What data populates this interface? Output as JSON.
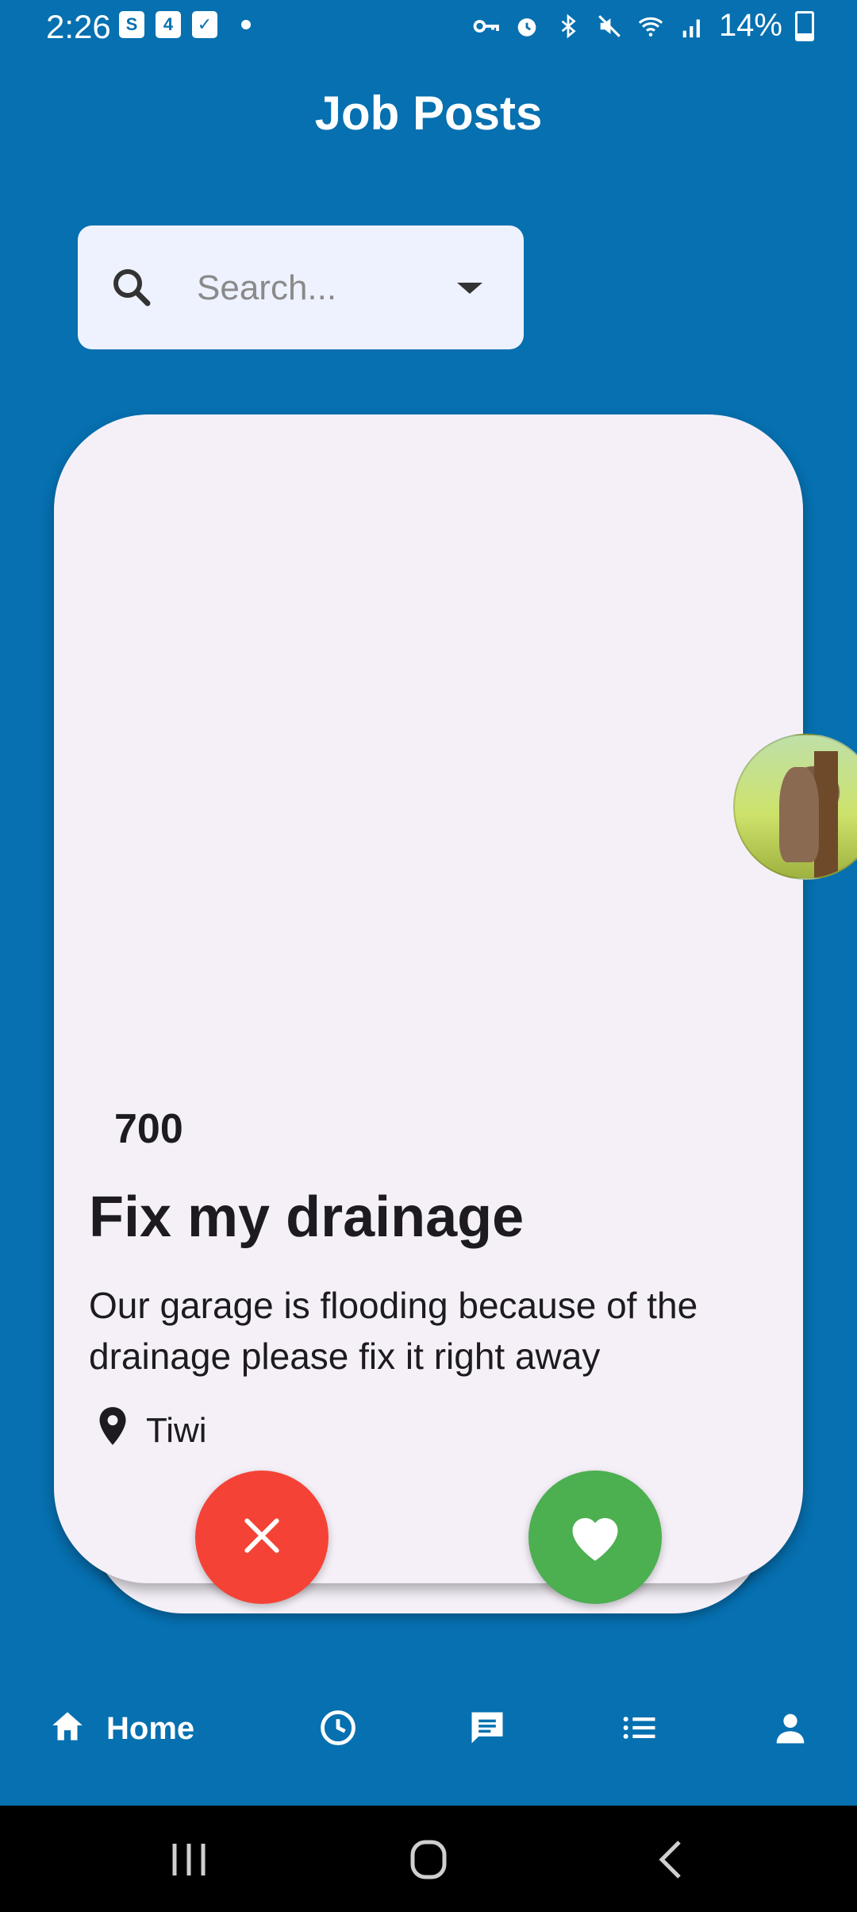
{
  "status_bar": {
    "time": "2:26",
    "mini_icon_2": "4",
    "battery": "14%"
  },
  "header": {
    "title": "Job Posts"
  },
  "search": {
    "placeholder": "Search..."
  },
  "job_card": {
    "price": "700",
    "title": "Fix my drainage",
    "description": "Our garage is flooding because of the drainage please fix it right away",
    "location": "Tiwi"
  },
  "nav": {
    "home_label": "Home",
    "items": [
      "home-icon",
      "history-icon",
      "chat-icon",
      "list-icon",
      "profile-icon"
    ]
  },
  "colors": {
    "background": "#0670b0",
    "card": "#f5f0f8",
    "reject": "#f44336",
    "like": "#4caf50",
    "search_bg": "#eef2ff"
  }
}
